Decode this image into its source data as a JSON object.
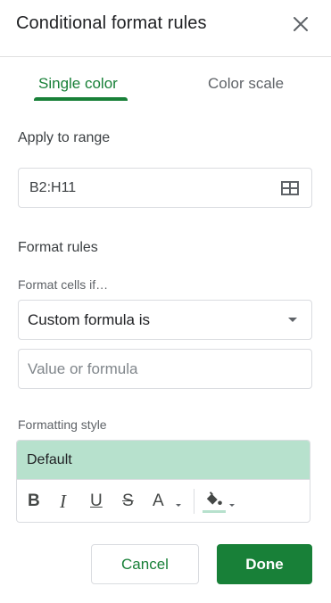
{
  "header": {
    "title": "Conditional format rules",
    "close_icon": "close-icon"
  },
  "tabs": [
    {
      "label": "Single color",
      "active": true
    },
    {
      "label": "Color scale",
      "active": false
    }
  ],
  "apply_range": {
    "label": "Apply to range",
    "value": "B2:H11",
    "icon": "grid-select-icon"
  },
  "format_rules": {
    "label": "Format rules",
    "condition_label": "Format cells if…",
    "condition_selected": "Custom formula is",
    "value_placeholder": "Value or formula"
  },
  "formatting_style": {
    "label": "Formatting style",
    "preview_text": "Default",
    "preview_color": "#b7e1cd",
    "tools": {
      "bold": "B",
      "italic": "I",
      "underline": "U",
      "strikethrough": "S",
      "text_color": "A",
      "fill_icon": "paint-bucket-icon"
    }
  },
  "actions": {
    "cancel_label": "Cancel",
    "done_label": "Done"
  },
  "colors": {
    "accent": "#188038",
    "preview_fill": "#b7e1cd"
  }
}
